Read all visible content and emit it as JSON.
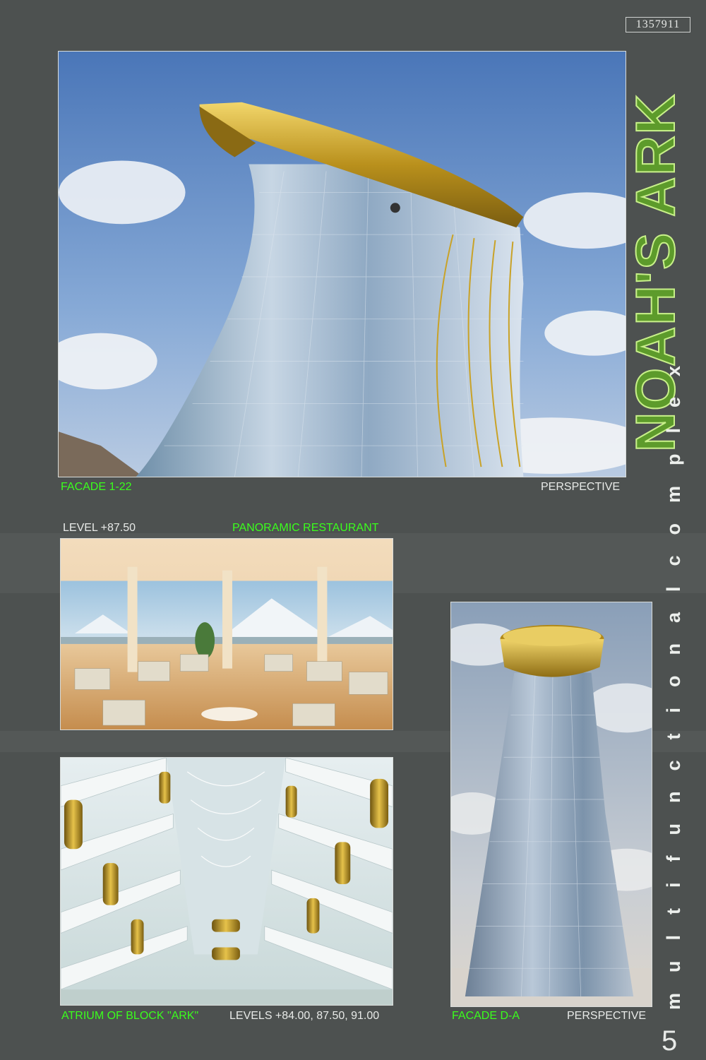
{
  "page": {
    "code": "1357911",
    "title": "NOAH'S ARK",
    "subtitle_part1": "complex",
    "subtitle_part2": "multifunctional",
    "page_number": "5"
  },
  "panels": {
    "facade_main": {
      "caption_left": "FACADE 1-22",
      "caption_right": "PERSPECTIVE"
    },
    "restaurant": {
      "caption_left": "LEVEL +87.50",
      "caption_right": "PANORAMIC RESTAURANT"
    },
    "atrium": {
      "caption_left": "ATRIUM OF BLOCK \"ARK\"",
      "caption_right": "LEVELS +84.00, 87.50, 91.00"
    },
    "facade_side": {
      "caption_left": "FACADE D-A",
      "caption_right": "PERSPECTIVE"
    }
  },
  "colors": {
    "background": "#4d5150",
    "caption_green": "#3aff1c",
    "title_green": "#5d9b2b",
    "gold": "#c9a227"
  }
}
